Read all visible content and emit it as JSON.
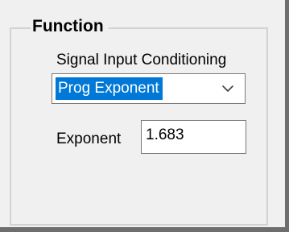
{
  "function_group": {
    "title": "Function",
    "signal_input_conditioning": {
      "label": "Signal Input Conditioning",
      "selected_value": "Prog Exponent",
      "dropdown_icon": "chevron-down-icon"
    },
    "exponent": {
      "label": "Exponent",
      "value": "1.683"
    }
  },
  "colors": {
    "panel_background": "#f0f0f0",
    "selection_highlight": "#0078d7",
    "field_border": "#7a7a7a",
    "group_border": "#d2d2d2"
  }
}
